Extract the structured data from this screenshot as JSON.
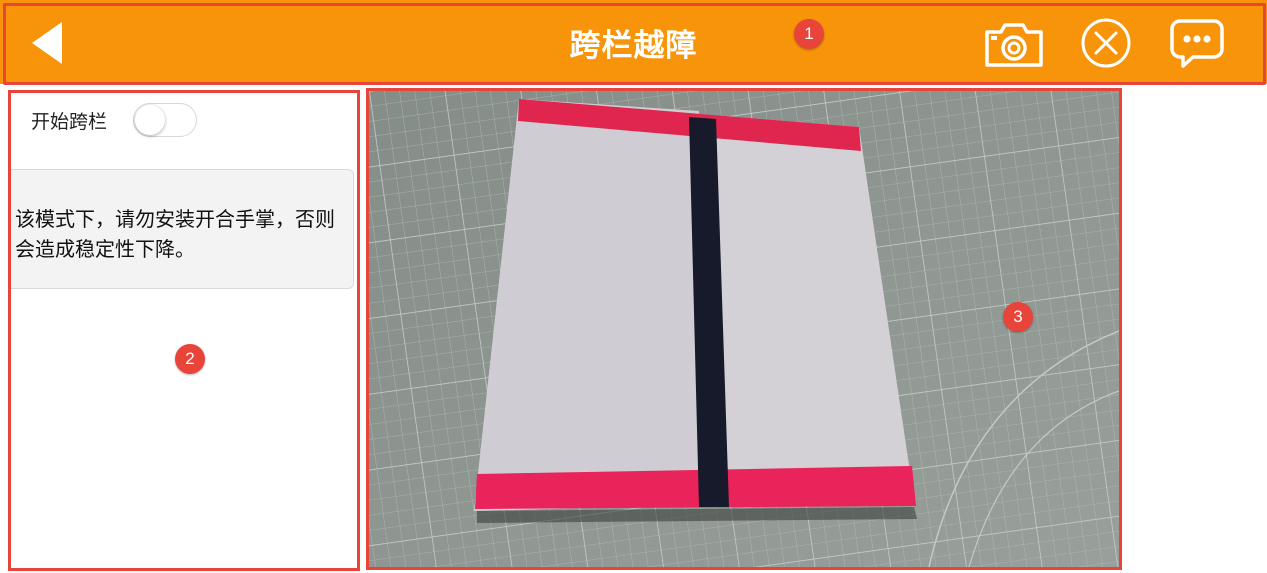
{
  "header": {
    "title": "跨栏越障",
    "icons": {
      "back": "back-arrow-icon",
      "camera": "camera-icon",
      "close": "close-circle-icon",
      "chat": "chat-bubble-icon"
    }
  },
  "control": {
    "toggle_label": "开始跨栏",
    "toggle_on": false
  },
  "notice": {
    "text": "该模式下，请勿安装开合手掌，否则会造成稳定性下降。"
  },
  "badges": [
    "1",
    "2",
    "3"
  ],
  "colors": {
    "header_bg": "#f7940a",
    "annotation_red": "#e8443a",
    "notice_bg": "#f3f3f3"
  }
}
